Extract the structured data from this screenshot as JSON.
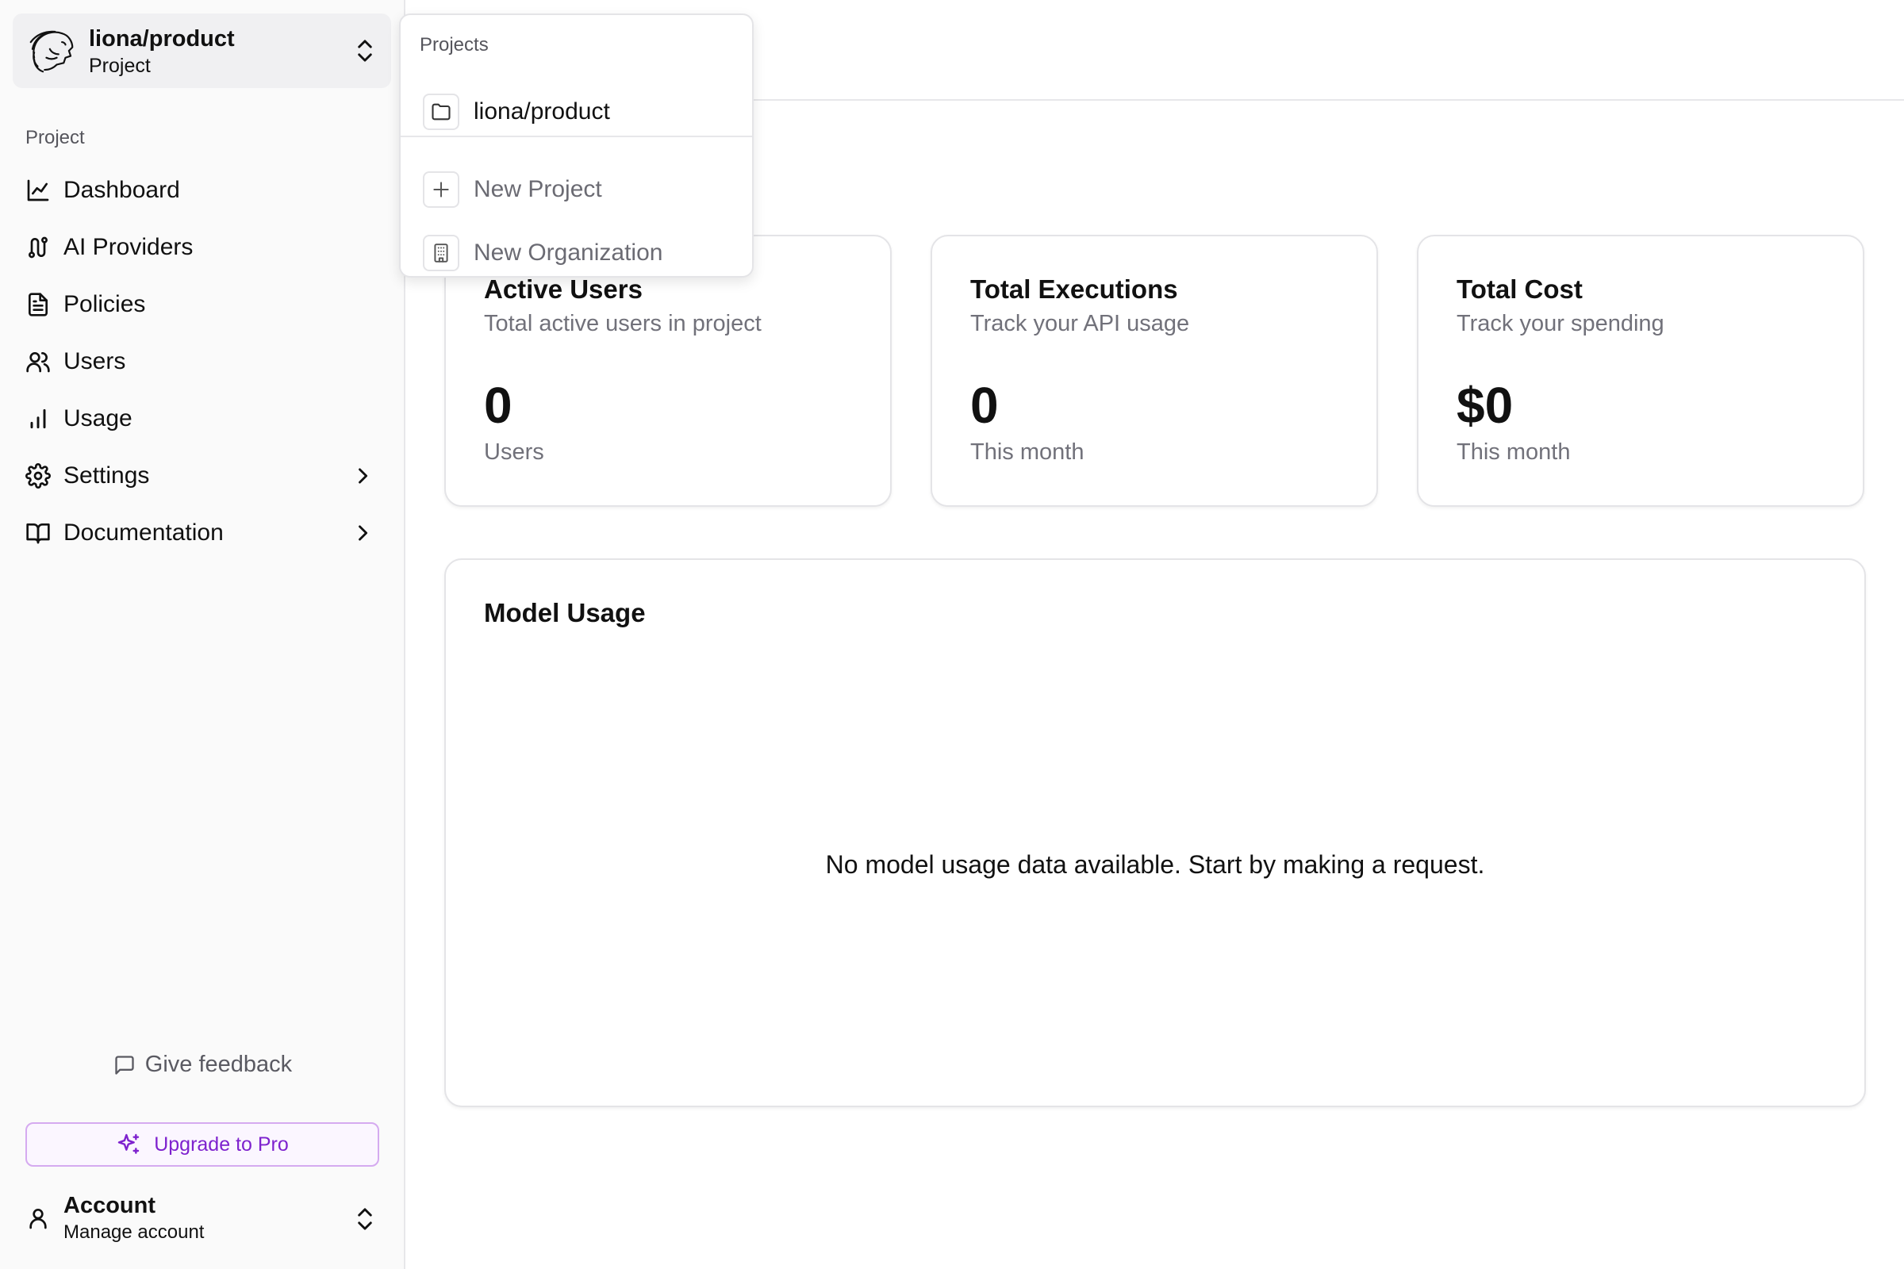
{
  "sidebar": {
    "project_switcher": {
      "name": "liona/product",
      "subtitle": "Project"
    },
    "section_label": "Project",
    "items": [
      {
        "label": "Dashboard",
        "icon": "line-chart-icon"
      },
      {
        "label": "AI Providers",
        "icon": "route-icon"
      },
      {
        "label": "Policies",
        "icon": "document-icon"
      },
      {
        "label": "Users",
        "icon": "users-icon"
      },
      {
        "label": "Usage",
        "icon": "bar-chart-icon"
      },
      {
        "label": "Settings",
        "icon": "gear-icon"
      },
      {
        "label": "Documentation",
        "icon": "book-icon"
      }
    ],
    "feedback_label": "Give feedback",
    "upgrade_label": "Upgrade to Pro",
    "account": {
      "title": "Account",
      "subtitle": "Manage account"
    }
  },
  "dropdown": {
    "header": "Projects",
    "project_item": "liona/product",
    "new_project": "New Project",
    "new_organization": "New Organization"
  },
  "stats": [
    {
      "title": "Active Users",
      "desc": "Total active users in project",
      "value": "0",
      "unit": "Users"
    },
    {
      "title": "Total Executions",
      "desc": "Track your API usage",
      "value": "0",
      "unit": "This month"
    },
    {
      "title": "Total Cost",
      "desc": "Track your spending",
      "value": "$0",
      "unit": "This month"
    }
  ],
  "model_usage": {
    "title": "Model Usage",
    "empty_message": "No model usage data available. Start by making a request."
  },
  "colors": {
    "accent_purple": "#7e22ce",
    "upgrade_border": "#d5aaf0",
    "muted_text": "#71717a"
  }
}
